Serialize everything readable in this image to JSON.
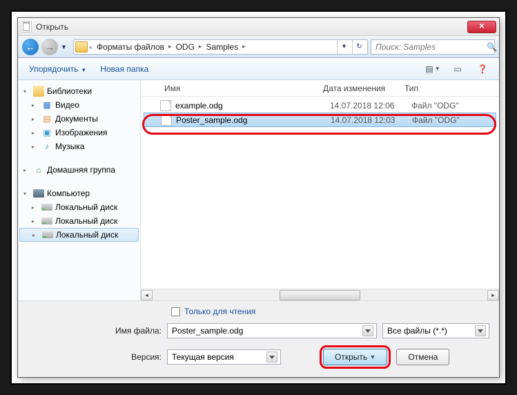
{
  "title": "Открыть",
  "breadcrumb": {
    "seg1": "Форматы файлов",
    "seg2": "ODG",
    "seg3": "Samples"
  },
  "search_placeholder": "Поиск: Samples",
  "toolbar": {
    "organize": "Упорядочить",
    "newfolder": "Новая папка"
  },
  "tree": {
    "libs": "Библиотеки",
    "video": "Видео",
    "docs": "Документы",
    "images": "Изображения",
    "music": "Музыка",
    "homegroup": "Домашняя группа",
    "computer": "Компьютер",
    "disk1": "Локальный диск",
    "disk2": "Локальный диск",
    "disk3": "Локальный диск"
  },
  "cols": {
    "name": "Имя",
    "date": "Дата изменения",
    "type": "Тип"
  },
  "files": [
    {
      "name": "example.odg",
      "date": "14.07.2018 12:06",
      "type": "Файл \"ODG\""
    },
    {
      "name": "Poster_sample.odg",
      "date": "14.07.2018 12:03",
      "type": "Файл \"ODG\""
    }
  ],
  "readonly": "Только для чтения",
  "labels": {
    "filename": "Имя файла:",
    "version": "Версия:"
  },
  "filename_value": "Poster_sample.odg",
  "filter": "Все файлы (*.*)",
  "version_value": "Текущая версия",
  "buttons": {
    "open": "Открыть",
    "cancel": "Отмена"
  }
}
